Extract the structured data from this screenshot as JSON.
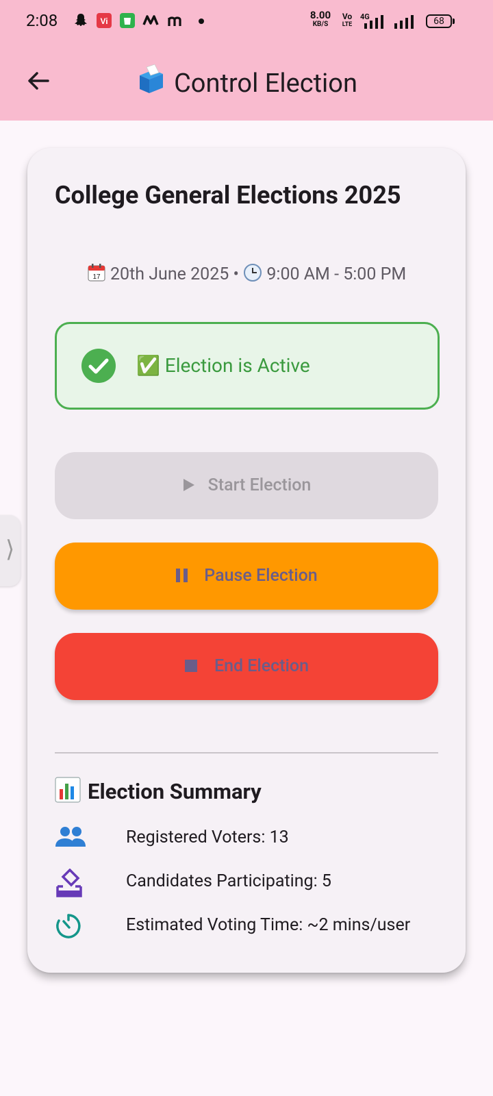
{
  "status_bar": {
    "time": "2:08",
    "net_speed_top": "8.00",
    "net_speed_bottom": "KB/S",
    "volte_top": "Vo",
    "volte_bottom": "LTE",
    "network": "4G",
    "battery": "68"
  },
  "app_bar": {
    "title": "Control Election",
    "title_icon": "ballot-box-icon",
    "back_icon": "arrow-left-icon"
  },
  "election": {
    "title": "College General Elections 2025",
    "date": "20th June 2025",
    "time_range": "9:00 AM - 5:00 PM",
    "separator": "•",
    "status_text": "✅ Election is Active",
    "status_color": "#4caf50"
  },
  "buttons": {
    "start": {
      "label": "Start Election",
      "icon": "play-icon",
      "enabled": false,
      "color": "#dfd9df"
    },
    "pause": {
      "label": "Pause Election",
      "icon": "pause-icon",
      "enabled": true,
      "color": "#ff9800"
    },
    "end": {
      "label": "End Election",
      "icon": "stop-icon",
      "enabled": true,
      "color": "#f44336"
    }
  },
  "summary": {
    "title": "Election Summary",
    "title_icon": "bar-chart-icon",
    "items": [
      {
        "label": "Registered Voters: 13",
        "icon": "people-icon",
        "color": "#2f7fd4"
      },
      {
        "label": "Candidates Participating: 5",
        "icon": "ballot-icon",
        "color": "#673ab7"
      },
      {
        "label": "Estimated Voting Time: ~2 mins/user",
        "icon": "timer-icon",
        "color": "#14968a"
      }
    ]
  },
  "side_handle": {
    "glyph": "⟩"
  }
}
